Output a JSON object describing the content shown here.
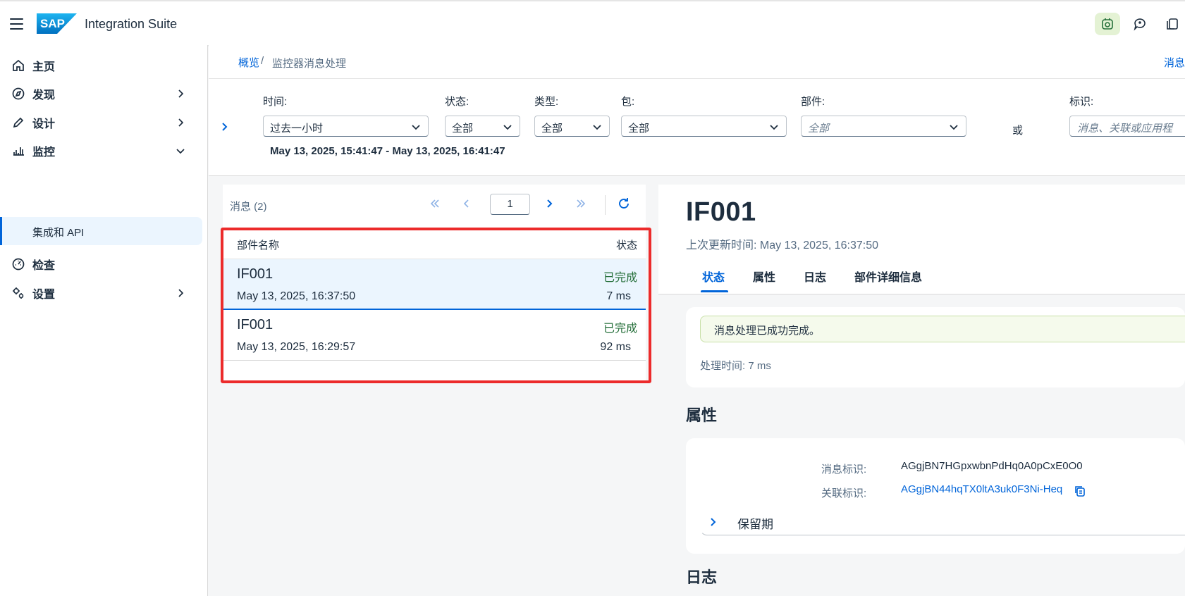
{
  "header": {
    "app_title": "Integration Suite",
    "logo_text": "SAP",
    "actions": [
      "connected-apps-icon",
      "feedback-icon",
      "notes-icon"
    ]
  },
  "sidenav": {
    "items": [
      {
        "label": "主页",
        "icon": "home-icon"
      },
      {
        "label": "发现",
        "icon": "compass-icon"
      },
      {
        "label": "设计",
        "icon": "pencil-icon"
      },
      {
        "label": "监控",
        "icon": "monitor-bars-icon"
      },
      {
        "label": "检查",
        "icon": "gauge-icon"
      },
      {
        "label": "设置",
        "icon": "settings-icon"
      }
    ],
    "sub_item": "集成和 API"
  },
  "breadcrumb": {
    "link": "概览",
    "separator": "/",
    "current": "监控器消息处理",
    "right_link": "消息"
  },
  "filters": {
    "time": {
      "label": "时间:",
      "value": "过去一小时"
    },
    "status": {
      "label": "状态:",
      "value": "全部"
    },
    "type": {
      "label": "类型:",
      "value": "全部"
    },
    "package": {
      "label": "包:",
      "value": "全部"
    },
    "artifact": {
      "label": "部件:",
      "placeholder": "全部"
    },
    "or_label": "或",
    "identifier": {
      "label": "标识:",
      "placeholder": "消息、关联或应用程"
    },
    "range": "May 13, 2025, 15:41:47 - May 13, 2025, 16:41:47"
  },
  "list": {
    "title": "消息 (2)",
    "page": "1",
    "col_name": "部件名称",
    "col_status": "状态",
    "rows": [
      {
        "name": "IF001",
        "status": "已完成",
        "date": "May 13, 2025, 16:37:50",
        "duration": "7 ms",
        "selected": true
      },
      {
        "name": "IF001",
        "status": "已完成",
        "date": "May 13, 2025, 16:29:57",
        "duration": "92 ms",
        "selected": false
      }
    ]
  },
  "detail": {
    "title": "IF001",
    "subtitle": "上次更新时间: May 13, 2025, 16:37:50",
    "tabs": [
      "状态",
      "属性",
      "日志",
      "部件详细信息"
    ],
    "status_message": "消息处理已成功完成。",
    "processing_time": "处理时间: 7 ms",
    "properties_title": "属性",
    "message_id_label": "消息标识:",
    "message_id": "AGgjBN7HGpxwbnPdHq0A0pCxE0O0",
    "correlation_id_label": "关联标识:",
    "correlation_id": "AGgjBN44hqTX0ltA3uk0F3Ni-Heq",
    "retention_label": "保留期",
    "logs_title": "日志"
  },
  "colors": {
    "accent": "#0064d9",
    "success": "#256f3a",
    "highlight": "#ec2b2b"
  }
}
